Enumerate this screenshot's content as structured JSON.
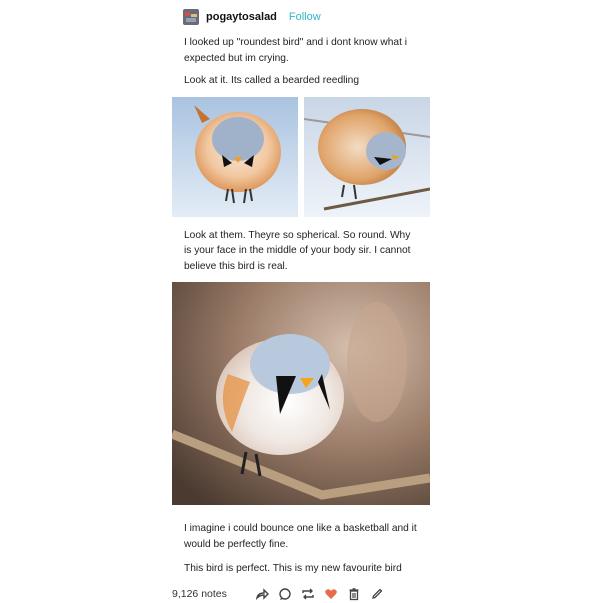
{
  "post": {
    "username": "pogaytosalad",
    "follow_label": "Follow",
    "paragraphs": [
      "I looked up \"roundest bird\" and i dont know what i expected but im crying.",
      "Look at it. Its called a bearded reedling",
      "Look at them. Theyre so spherical. So round. Why is your face in the middle of your body sir. I cannot believe this bird is real.",
      "I imagine i could bounce one like a basketball and it would be perfectly fine.",
      "This bird is perfect. This is my new favourite bird"
    ],
    "notes_count": "9,126 notes"
  },
  "footer_icons": [
    "share-icon",
    "reply-icon",
    "reblog-icon",
    "like-icon",
    "delete-icon",
    "edit-icon"
  ],
  "colors": {
    "follow": "#2fb3c8",
    "like": "#e86b4b"
  }
}
